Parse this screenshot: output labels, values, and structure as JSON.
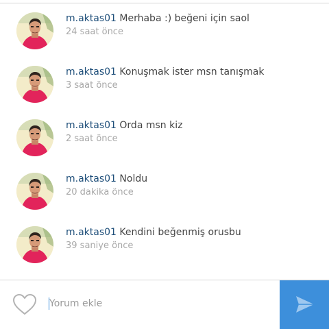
{
  "comments": [
    {
      "username": "m.aktas01",
      "text": "Merhaba :) beğeni için saol",
      "time": "24 saat önce"
    },
    {
      "username": "m.aktas01",
      "text": "Konuşmak ister msn tanışmak",
      "time": "3 saat önce"
    },
    {
      "username": "m.aktas01",
      "text": "Orda msn kiz",
      "time": "2 saat önce"
    },
    {
      "username": "m.aktas01",
      "text": "Noldu",
      "time": "20 dakika önce"
    },
    {
      "username": "m.aktas01",
      "text": "Kendini beğenmiş orusbu",
      "time": "39 saniye önce"
    }
  ],
  "input": {
    "placeholder": "Yorum ekle",
    "value": ""
  },
  "icons": {
    "like": "heart-outline-icon",
    "send": "paper-plane-icon",
    "avatar": "user-avatar"
  },
  "colors": {
    "username": "#1f4f7a",
    "time": "#a8a8a8",
    "send_button": "#3d8fdb",
    "like_icon": "#b3b3b3"
  }
}
